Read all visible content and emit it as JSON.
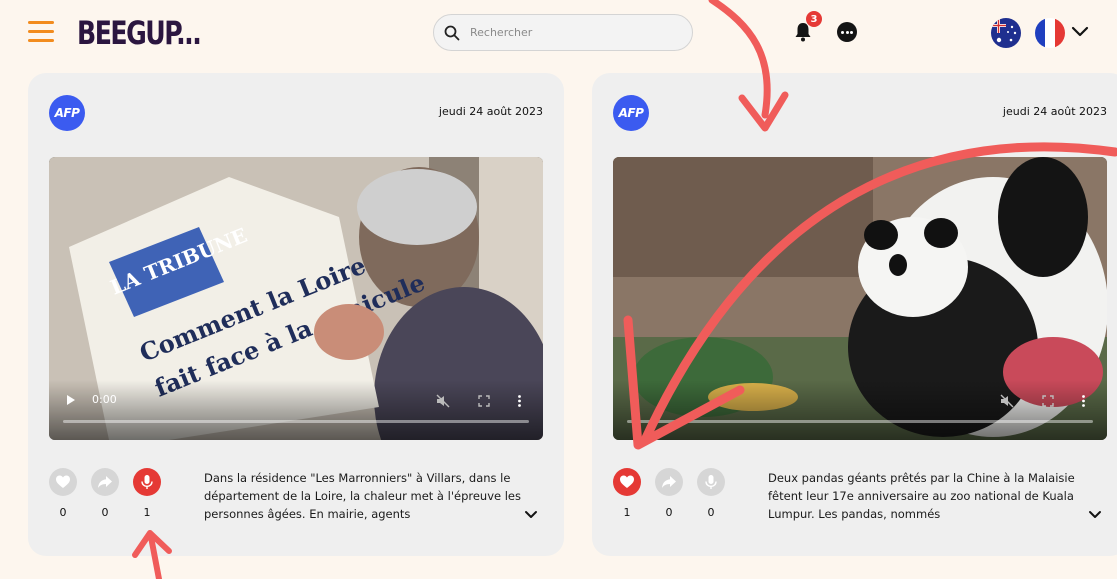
{
  "header": {
    "logo": "BEEGUP...",
    "search_placeholder": "Rechercher",
    "notification_count": "3"
  },
  "colors": {
    "accent_orange": "#f28c1e",
    "logo_purple": "#2b1640",
    "like_red": "#e53935",
    "afp_blue": "#3b5bf0",
    "annotation_red": "#f05c5a"
  },
  "cards": [
    {
      "source": "AFP",
      "date": "jeudi 24 août 2023",
      "video_time": "0:00",
      "counts": {
        "like": "0",
        "share": "0",
        "audio": "1"
      },
      "active": "audio",
      "summary": "Dans la résidence \"Les Marronniers\" à Villars, dans le département de la Loire, la chaleur met à l'épreuve les personnes âgées. En mairie, agents",
      "headline_in_image": [
        "LA TRIBUNE",
        "Comment la Loire",
        "fait face à la canicule"
      ]
    },
    {
      "source": "AFP",
      "date": "jeudi 24 août 2023",
      "video_time": "",
      "counts": {
        "like": "1",
        "share": "0",
        "audio": "0"
      },
      "active": "like",
      "summary": "Deux pandas géants prêtés par la Chine à la Malaisie fêtent leur 17e anniversaire au zoo national de Kuala Lumpur. Les pandas, nommés"
    }
  ]
}
